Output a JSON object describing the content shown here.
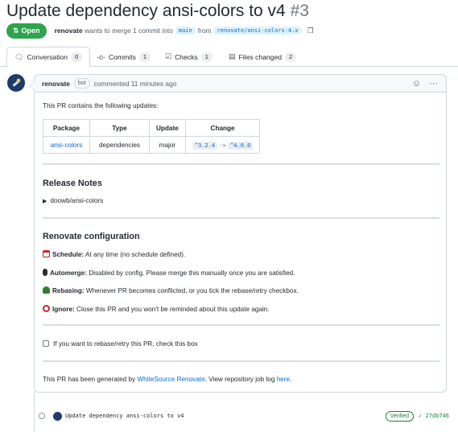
{
  "pr": {
    "title": "Update dependency ansi-colors to v4",
    "number": "#3",
    "state": "Open",
    "author": "renovate",
    "merge_text": "wants to merge 1 commit into",
    "base_branch": "main",
    "from_text": "from",
    "head_branch": "renovate/ansi-colors-4.x"
  },
  "tabs": [
    {
      "label": "Conversation",
      "count": "0"
    },
    {
      "label": "Commits",
      "count": "1"
    },
    {
      "label": "Checks",
      "count": "1"
    },
    {
      "label": "Files changed",
      "count": "2"
    }
  ],
  "comment": {
    "author": "renovate",
    "badge": "bot",
    "time": "commented 11 minutes ago",
    "intro": "This PR contains the following updates:",
    "table": {
      "headers": [
        "Package",
        "Type",
        "Update",
        "Change"
      ],
      "row": {
        "package": "ansi-colors",
        "type": "dependencies",
        "update": "major",
        "change_from": "^3.2.4",
        "arrow": "->",
        "change_to": "^4.0.0"
      }
    },
    "release_notes_title": "Release Notes",
    "release_notes_item": "doowb/ansi-colors",
    "config_title": "Renovate configuration",
    "config": [
      {
        "label": "Schedule:",
        "text": "At any time (no schedule defined).",
        "color": "#e8e8e8"
      },
      {
        "label": "Automerge:",
        "text": "Disabled by config. Please merge this manually once you are satisfied.",
        "color": "#2e7d32"
      },
      {
        "label": "Rebasing:",
        "text": "Whenever PR becomes conflicted, or you tick the rebase/retry checkbox.",
        "color": "#2e7d32"
      },
      {
        "label": "Ignore:",
        "text": "Close this PR and you won't be reminded about this update again.",
        "color": "#c62828"
      }
    ],
    "rebase_checkbox": "If you want to rebase/retry this PR, check this box",
    "footer_pre": "This PR has been generated by",
    "footer_link": "WhiteSource Renovate",
    "footer_mid": ". View repository job log",
    "footer_link2": "here",
    "footer_end": "."
  },
  "commit": {
    "message": "Update dependency ansi-colors to v4",
    "verified": "Verified",
    "sha": "27db746"
  },
  "colors": {
    "open": "#2da44e",
    "link": "#0969da"
  }
}
